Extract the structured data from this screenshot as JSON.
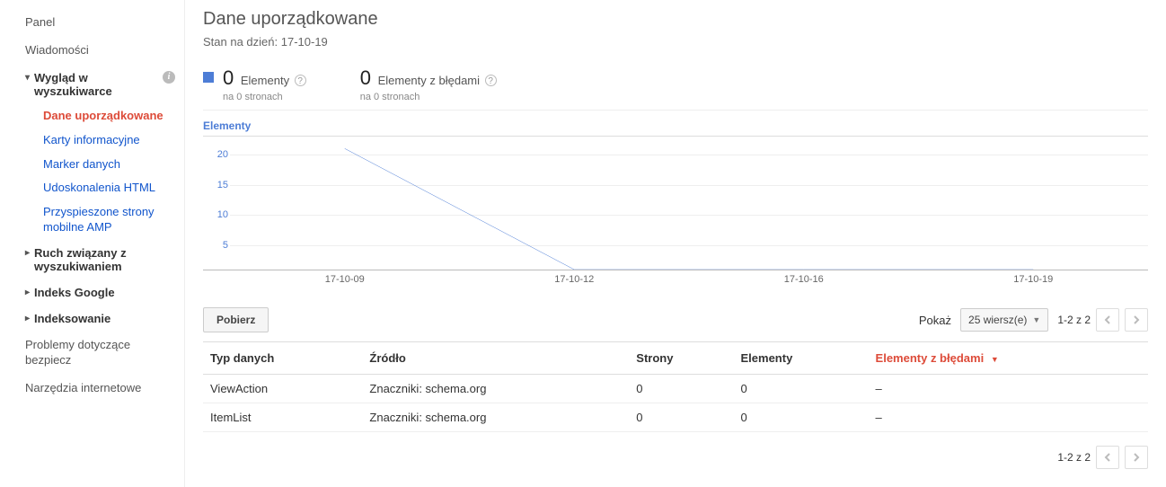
{
  "sidebar": {
    "top": [
      {
        "label": "Panel"
      },
      {
        "label": "Wiadomości"
      }
    ],
    "groups": [
      {
        "label": "Wygląd w wyszukiwarce",
        "expanded": true,
        "info": true,
        "children": [
          {
            "label": "Dane uporządkowane",
            "active": true
          },
          {
            "label": "Karty informacyjne"
          },
          {
            "label": "Marker danych"
          },
          {
            "label": "Udoskonalenia HTML"
          },
          {
            "label": "Przyspieszone strony mobilne AMP"
          }
        ]
      },
      {
        "label": "Ruch związany z wyszukiwaniem",
        "expanded": false
      },
      {
        "label": "Indeks Google",
        "expanded": false
      },
      {
        "label": "Indeksowanie",
        "expanded": false
      }
    ],
    "bottom": [
      {
        "label": "Problemy dotyczące bezpiecz"
      },
      {
        "label": "Narzędzia internetowe"
      }
    ]
  },
  "page": {
    "title": "Dane uporządkowane",
    "status_prefix": "Stan na dzień: ",
    "status_date": "17-10-19"
  },
  "stats": {
    "items": {
      "series_label": "Elementy",
      "value": "0",
      "sub": "na 0 stronach"
    },
    "errors": {
      "series_label": "Elementy z błędami",
      "value": "0",
      "sub": "na 0 stronach"
    }
  },
  "chart_data": {
    "type": "line",
    "title": "Elementy",
    "ylabel": "",
    "xlabel": "",
    "ylim": [
      0,
      22
    ],
    "yticks": [
      5,
      10,
      15,
      20
    ],
    "categories": [
      "17-10-09",
      "17-10-12",
      "17-10-16",
      "17-10-19"
    ],
    "series": [
      {
        "name": "Elementy",
        "values": [
          20,
          0,
          0,
          0
        ],
        "color": "#4d7dd6"
      }
    ]
  },
  "toolbar": {
    "download_label": "Pobierz",
    "show_label": "Pokaż",
    "rows_select": "25 wiersz(e)",
    "page_info": "1-2 z 2"
  },
  "table": {
    "columns": [
      {
        "label": "Typ danych"
      },
      {
        "label": "Źródło"
      },
      {
        "label": "Strony"
      },
      {
        "label": "Elementy"
      },
      {
        "label": "Elementy z błędami",
        "sorted": true
      }
    ],
    "rows": [
      {
        "type": "ViewAction",
        "source": "Znaczniki: schema.org",
        "pages": "0",
        "elements": "0",
        "errors": "–"
      },
      {
        "type": "ItemList",
        "source": "Znaczniki: schema.org",
        "pages": "0",
        "elements": "0",
        "errors": "–"
      }
    ]
  }
}
